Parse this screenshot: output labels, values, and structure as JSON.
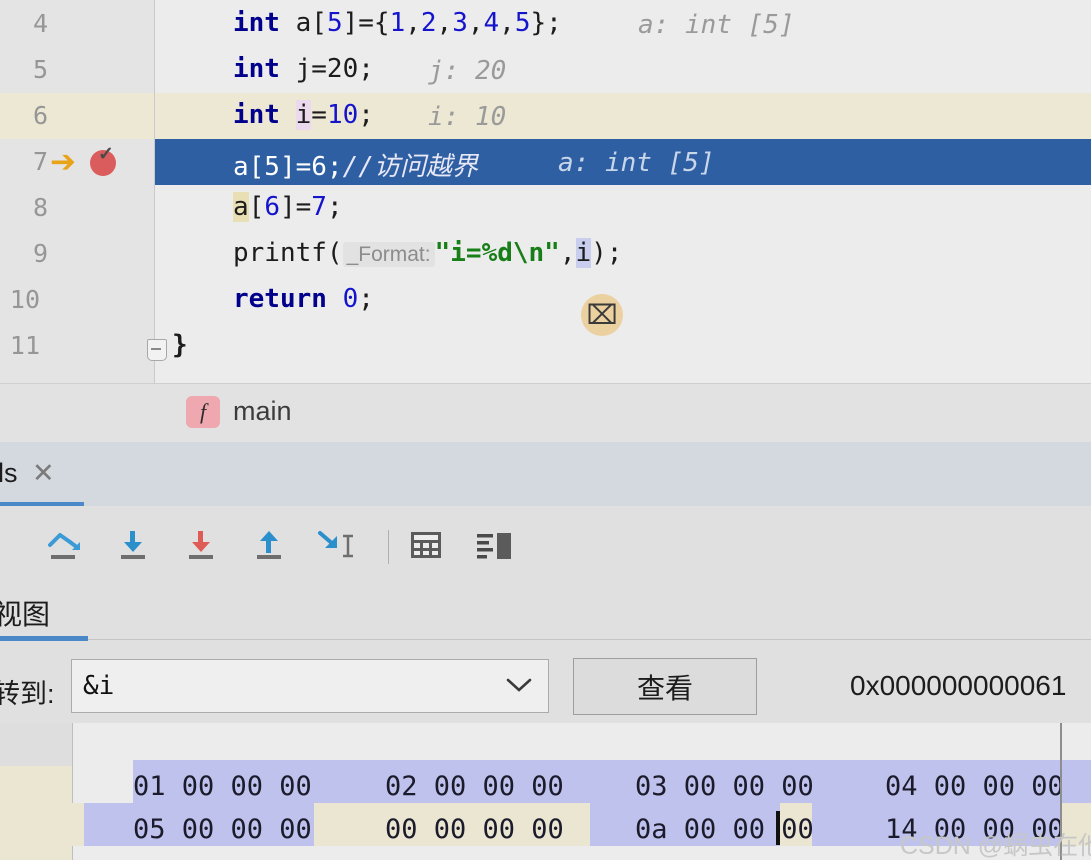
{
  "editor": {
    "lines": [
      {
        "no": "4",
        "indent": "",
        "tokens": "int a[5]={1,2,3,4,5};",
        "hint": "a: int [5]"
      },
      {
        "no": "5",
        "indent": "",
        "tokens": "int j=20;",
        "hint": "j: 20"
      },
      {
        "no": "6",
        "indent": "",
        "tokens": "int i=10;",
        "hint": "i: 10"
      },
      {
        "no": "7",
        "indent": "",
        "tokens": "a[5]=6;//访问越界",
        "hint": "a: int [5]"
      },
      {
        "no": "8",
        "indent": "",
        "tokens": "a[6]=7;",
        "hint": ""
      },
      {
        "no": "9",
        "indent": "",
        "tokens": "printf( _Format: \"i=%d\\n\",i);",
        "hint": ""
      },
      {
        "no": "10",
        "indent": "",
        "tokens": "return 0;",
        "hint": ""
      },
      {
        "no": "11",
        "indent": "",
        "tokens": "}",
        "hint": ""
      }
    ],
    "line4": {
      "kw": "int",
      "a": " a",
      "b1": "[",
      "five": "5",
      "b2": "]={",
      "n1": "1",
      "c1": ",",
      "n2": "2",
      "c2": ",",
      "n3": "3",
      "c3": ",",
      "n4": "4",
      "c4": ",",
      "n5": "5",
      "tail": "};",
      "hint": "a: int [5]"
    },
    "line5": {
      "kw": "int",
      "var": " j=20;",
      "hint": "j: 20"
    },
    "line6": {
      "kw": "int",
      "sp": " ",
      "var": "i",
      "rest": "=",
      "num": "10",
      "semi": ";",
      "hint": "i: 10"
    },
    "line7": {
      "code": "a[5]=6;",
      "comment": "//访问越界",
      "hint": "a: int [5]"
    },
    "line8": {
      "a": "a",
      "b1": "[",
      "six": "6",
      "b2": "]=",
      "seven": "7",
      "semi": ";"
    },
    "line9": {
      "fn": "printf(",
      "paramhint": "_Format:",
      "str": "\"i=%d\\n\"",
      "comma": ",",
      "arg": "i",
      "tail": ");"
    },
    "line10": {
      "kw": "return",
      "num": " 0",
      "semi": ";"
    },
    "line11": {
      "brace": "}"
    },
    "gutter": {
      "exec_arrow_icon": "execution-pointer-arrow",
      "breakpoint_icon": "breakpoint-verified",
      "fold_icon": "code-fold-collapse"
    },
    "mouse_cursor_icon": "i-beam-text-cursor"
  },
  "breadcrumb": {
    "icon": "f",
    "icon_name": "function-icon",
    "label": "main"
  },
  "debug": {
    "tab_label": "ls",
    "tab_close": "✕",
    "toolbar": [
      {
        "name": "step-over-icon",
        "title": "Step Over"
      },
      {
        "name": "step-into-icon",
        "title": "Step Into"
      },
      {
        "name": "force-step-into-icon",
        "title": "Force Step Into"
      },
      {
        "name": "step-out-icon",
        "title": "Step Out"
      },
      {
        "name": "run-to-cursor-icon",
        "title": "Run to Cursor"
      },
      {
        "name": "evaluate-expression-icon",
        "title": "Evaluate Expression"
      },
      {
        "name": "layout-settings-icon",
        "title": "Layout Settings"
      }
    ]
  },
  "memory": {
    "tab_label": "视图",
    "goto_label": "转到:",
    "goto_value": "&i",
    "goto_placeholder": "",
    "view_button": "查看",
    "address": "0x000000000061",
    "dropdown_arrow": "∨",
    "rows": [
      {
        "groups": [
          "01 00 00 00",
          "02 00 00 00",
          "03 00 00 00",
          "04 00 00 00"
        ]
      },
      {
        "groups": [
          "05 00 00 00",
          "00 00 00 00",
          "0a 00 00 00",
          "14 00 00 00"
        ]
      }
    ]
  },
  "watermark": "CSDN @蜗虫在他乡",
  "colors": {
    "exec_line": "#2E5FA3",
    "current_line": "#EDE8D3",
    "accent": "#4A88C7",
    "breakpoint": "#DB5C5C",
    "hex_selection": "#BFC2EC",
    "hex_modified": "#EAE6D2"
  }
}
